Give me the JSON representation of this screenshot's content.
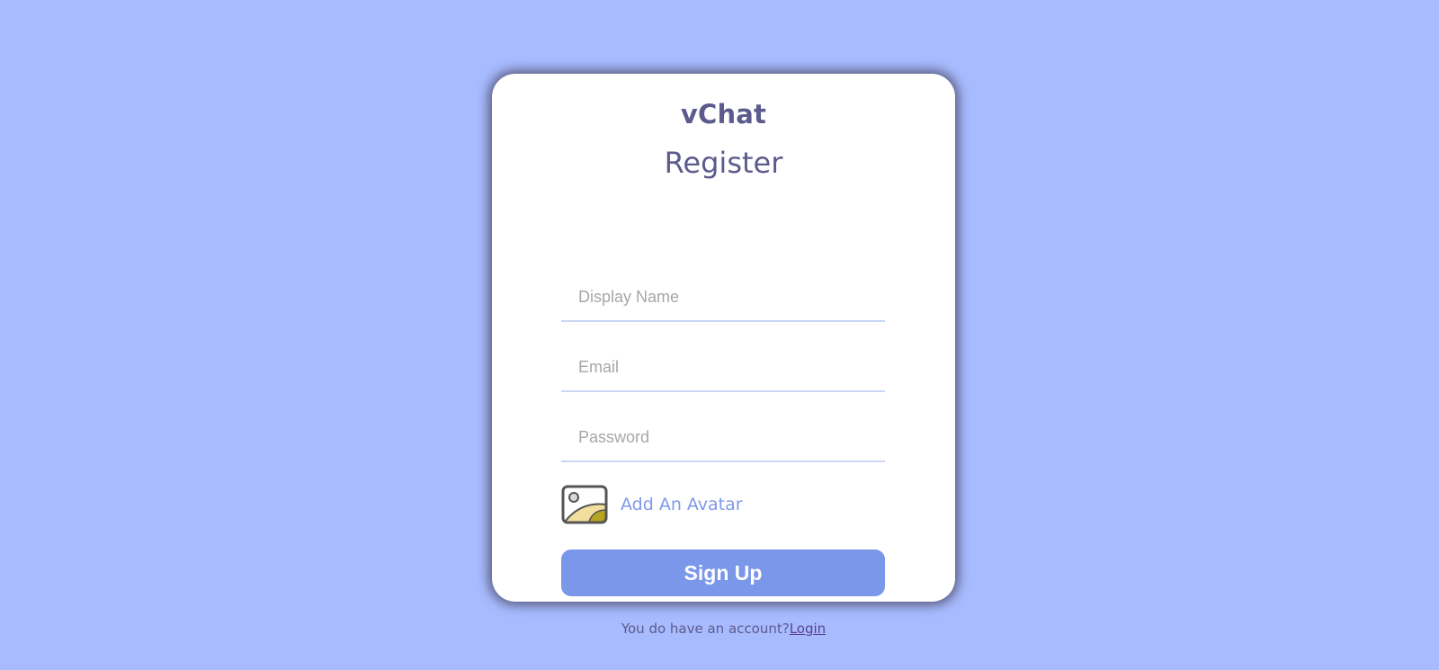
{
  "app": {
    "logo": "vChat",
    "form_title": "Register"
  },
  "form": {
    "display_name": {
      "value": "",
      "placeholder": "Display Name"
    },
    "email": {
      "value": "",
      "placeholder": "Email"
    },
    "password": {
      "value": "",
      "placeholder": "Password"
    },
    "avatar_label": "Add An Avatar",
    "submit_label": "Sign Up"
  },
  "footer": {
    "text": "You do have an account?",
    "link_label": "Login"
  },
  "icons": {
    "avatar": "image-icon"
  },
  "colors": {
    "background": "#a7bbfe",
    "accent": "#7b97ea",
    "brand_text": "#5d5b8d"
  }
}
